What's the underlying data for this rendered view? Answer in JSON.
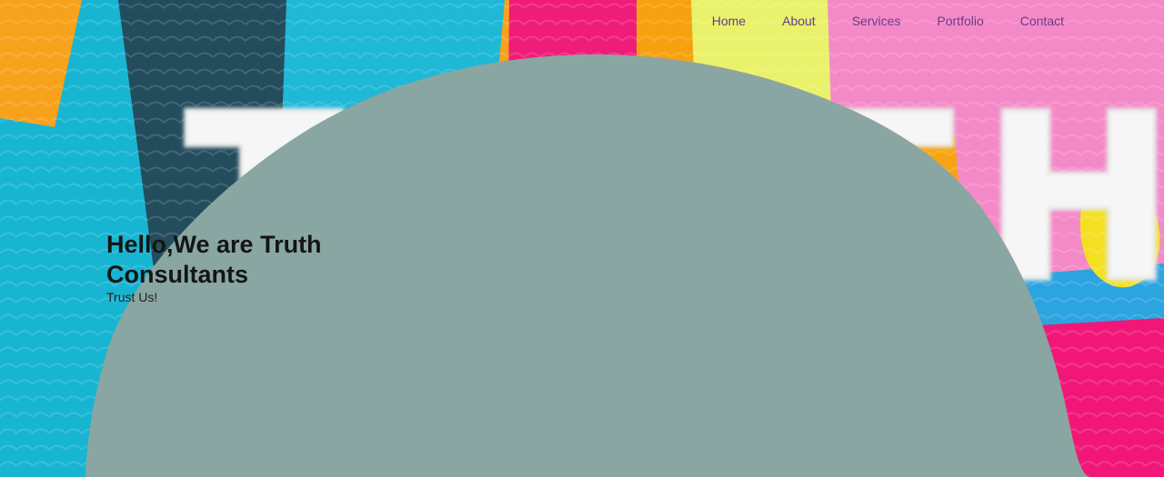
{
  "nav": {
    "items": [
      {
        "label": "Home"
      },
      {
        "label": "About"
      },
      {
        "label": "Services"
      },
      {
        "label": "Portfolio"
      },
      {
        "label": "Contact"
      }
    ]
  },
  "hero": {
    "title": "Hello,We are Truth Consultants",
    "subtitle": "Trust Us!",
    "logo_word": "TRUTH"
  },
  "colors": {
    "background": "#8aa6a2",
    "nav_text": "#6a3b86",
    "logo_fill": "#f6f6f6"
  }
}
